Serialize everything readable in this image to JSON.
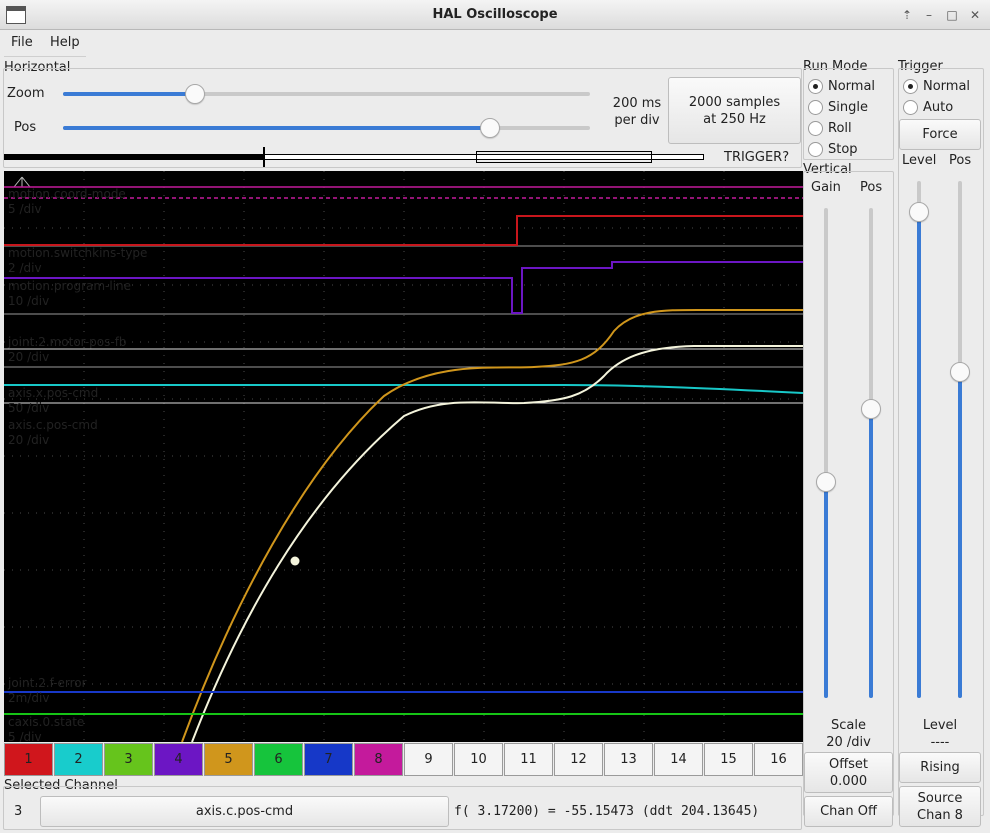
{
  "window": {
    "title": "HAL Oscilloscope",
    "controls": [
      "⇡",
      "–",
      "□",
      "✕"
    ]
  },
  "menu": [
    "File",
    "Help"
  ],
  "horizontal": {
    "title": "Horizontal",
    "zoom_label": "Zoom",
    "pos_label": "Pos",
    "zoom_fraction": 0.25,
    "pos_fraction": 0.81,
    "per_div_line1": "200 ms",
    "per_div_line2": "per div",
    "samples_line1": "2000 samples",
    "samples_line2": "at 250 Hz",
    "trigger_status": "TRIGGER?"
  },
  "run_mode": {
    "title": "Run Mode",
    "options": [
      "Normal",
      "Single",
      "Roll",
      "Stop"
    ],
    "selected": 0
  },
  "trigger": {
    "title": "Trigger",
    "options": [
      "Normal",
      "Auto"
    ],
    "selected": 0,
    "force_label": "Force",
    "level_label": "Level",
    "pos_label": "Pos",
    "level_fraction": 0.94,
    "pos_fraction": 0.63,
    "level_text": "Level",
    "level_value": "----",
    "edge_button": "Rising",
    "source_line1": "Source",
    "source_line2": "Chan  8"
  },
  "vertical": {
    "title": "Vertical",
    "gain_label": "Gain",
    "pos_label": "Pos",
    "gain_fraction": 0.44,
    "pos_fraction": 0.59,
    "scale_label": "Scale",
    "scale_value": "20 /div",
    "offset_label": "Offset",
    "offset_value": "0.000",
    "chan_off": "Chan Off"
  },
  "traces": [
    {
      "name": "motion.coord-mode",
      "scale": "5 /div",
      "color": "#c41a9c"
    },
    {
      "name": "motion.switchkins-type",
      "scale": "2 /div",
      "color": "#c8161c"
    },
    {
      "name": "motion.program-line",
      "scale": "10 /div",
      "color": "#6c16c4"
    },
    {
      "name": "joint.2.motor-pos-fb",
      "scale": "20 /div",
      "color": "#d0961c"
    },
    {
      "name": "axis.x.pos-cmd",
      "scale": "50 /div",
      "color": "#18c8c8"
    },
    {
      "name": "axis.c.pos-cmd",
      "scale": "20 /div",
      "color": "#f4f4dc"
    },
    {
      "name": "joint.2.f-error",
      "scale": "2m/div",
      "color": "#1838c8"
    },
    {
      "name": "caxis.0.state",
      "scale": "5 /div",
      "color": "#16c416"
    }
  ],
  "channels": [
    {
      "label": "1",
      "color": "#d0161c"
    },
    {
      "label": "2",
      "color": "#18cccc"
    },
    {
      "label": "3",
      "color": "#66c41c"
    },
    {
      "label": "4",
      "color": "#6c16c4"
    },
    {
      "label": "5",
      "color": "#d0961c"
    },
    {
      "label": "6",
      "color": "#16c43c"
    },
    {
      "label": "7",
      "color": "#1638c8"
    },
    {
      "label": "8",
      "color": "#c41a9c"
    },
    {
      "label": "9",
      "color": "#f4f4f4"
    },
    {
      "label": "10",
      "color": "#f4f4f4"
    },
    {
      "label": "11",
      "color": "#f4f4f4"
    },
    {
      "label": "12",
      "color": "#f4f4f4"
    },
    {
      "label": "13",
      "color": "#f4f4f4"
    },
    {
      "label": "14",
      "color": "#f4f4f4"
    },
    {
      "label": "15",
      "color": "#f4f4f4"
    },
    {
      "label": "16",
      "color": "#f4f4f4"
    }
  ],
  "selected_channel": {
    "title": "Selected Channel",
    "number": "3",
    "signal": "axis.c.pos-cmd",
    "readout": "f( 3.17200) = -55.15473 (ddt  204.13645)"
  }
}
